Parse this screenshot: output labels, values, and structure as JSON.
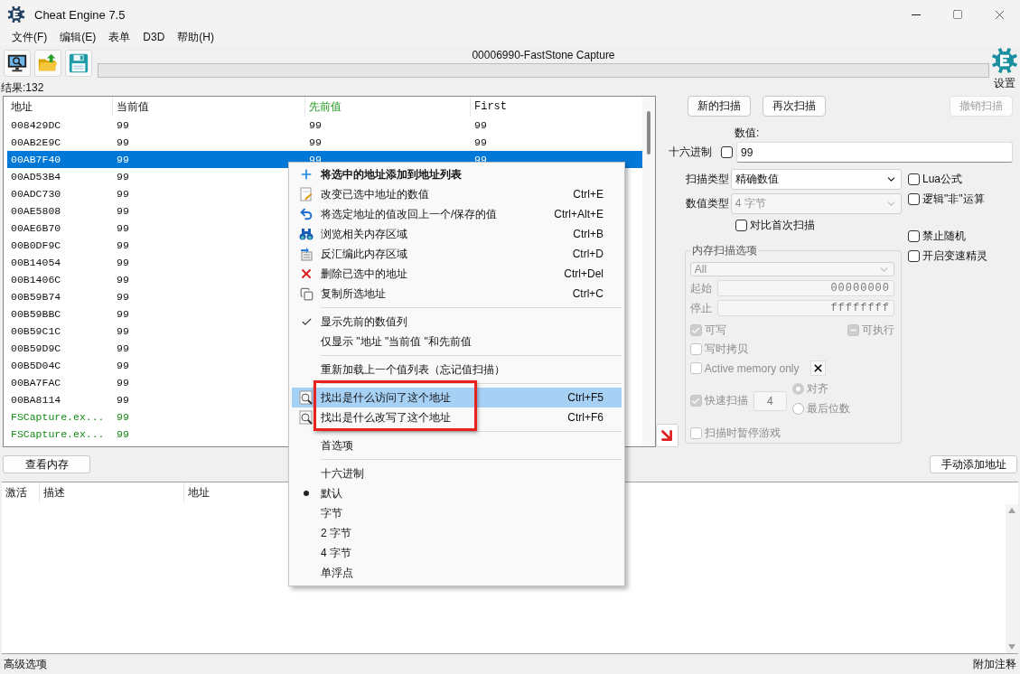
{
  "window": {
    "title": "Cheat Engine 7.5"
  },
  "menu": [
    "文件(F)",
    "编辑(E)",
    "表单",
    "D3D",
    "帮助(H)"
  ],
  "process": "00006990-FastStone Capture",
  "progress": {
    "level": 0
  },
  "settings_label": "设置",
  "result_count": "结果:132",
  "results": {
    "columns": [
      {
        "label": "地址",
        "highlight": false
      },
      {
        "label": "当前值",
        "highlight": false
      },
      {
        "label": "先前值",
        "highlight": true
      },
      {
        "label": "First",
        "highlight": false
      }
    ],
    "rows": [
      {
        "kind": "static",
        "address": "008429DC",
        "value": "99",
        "previous": "99",
        "first": "99",
        "selected": false
      },
      {
        "kind": "static",
        "address": "00AB2E9C",
        "value": "99",
        "previous": "99",
        "first": "99",
        "selected": false
      },
      {
        "kind": "static",
        "address": "00AB7F40",
        "value": "99",
        "previous": "99",
        "first": "99",
        "selected": true
      },
      {
        "kind": "static",
        "address": "00AD53B4",
        "value": "99",
        "selected": false
      },
      {
        "kind": "static",
        "address": "00ADC730",
        "value": "99",
        "selected": false
      },
      {
        "kind": "static",
        "address": "00AE5808",
        "value": "99",
        "selected": false
      },
      {
        "kind": "static",
        "address": "00AE6B70",
        "value": "99",
        "selected": false
      },
      {
        "kind": "static",
        "address": "00B0DF9C",
        "value": "99",
        "selected": false
      },
      {
        "kind": "static",
        "address": "00B14054",
        "value": "99",
        "selected": false
      },
      {
        "kind": "static",
        "address": "00B1406C",
        "value": "99",
        "selected": false
      },
      {
        "kind": "static",
        "address": "00B59B74",
        "value": "99",
        "selected": false
      },
      {
        "kind": "static",
        "address": "00B59BBC",
        "value": "99",
        "selected": false
      },
      {
        "kind": "static",
        "address": "00B59C1C",
        "value": "99",
        "selected": false
      },
      {
        "kind": "static",
        "address": "00B59D9C",
        "value": "99",
        "selected": false
      },
      {
        "kind": "static",
        "address": "00B5D04C",
        "value": "99",
        "selected": false
      },
      {
        "kind": "static",
        "address": "00BA7FAC",
        "value": "99",
        "selected": false
      },
      {
        "kind": "static",
        "address": "00BA8114",
        "value": "99",
        "selected": false
      },
      {
        "kind": "module",
        "address": "FSCapture.ex...",
        "value": "99",
        "selected": false
      },
      {
        "kind": "module",
        "address": "FSCapture.ex...",
        "value": "99",
        "selected": false
      }
    ]
  },
  "scan_buttons": [
    {
      "label": "新的扫描",
      "disabled": false
    },
    {
      "label": "再次扫描",
      "disabled": false
    },
    {
      "label": "撤销扫描",
      "disabled": true
    }
  ],
  "value": {
    "label": "数值:",
    "hex_label": "十六进制",
    "hex_checked": false,
    "value": "99"
  },
  "scan_type": {
    "label": "扫描类型",
    "value": "精确数值",
    "disabled": false
  },
  "value_type": {
    "label": "数值类型",
    "value": "4 字节",
    "disabled": true
  },
  "compare_first": {
    "label": "对比首次扫描",
    "checked": false
  },
  "options_top": [
    {
      "label": "Lua公式",
      "checked": false
    },
    {
      "label": "逻辑\"非\"运算",
      "checked": false
    }
  ],
  "options_bottom": [
    {
      "label": "禁止随机",
      "checked": false
    },
    {
      "label": "开启变速精灵",
      "checked": false
    }
  ],
  "memory_scan": {
    "title": "内存扫描选项",
    "disabled": true,
    "region": "All",
    "start_label": "起始",
    "start": "00000000",
    "stop_label": "停止",
    "stop": "ffffffff",
    "writable": {
      "label": "可写",
      "checked": true
    },
    "executable": {
      "label": "可执行",
      "indeterminate": true
    },
    "copy_on_write": {
      "label": "写时拷贝",
      "checked": false
    },
    "active_memory": {
      "label": "Active memory only",
      "checked": false
    },
    "fast_scan": {
      "label": "快速扫描",
      "checked": true,
      "value": "4"
    },
    "alignment": [
      {
        "label": "对齐",
        "selected": true
      },
      {
        "label": "最后位数",
        "selected": false
      }
    ],
    "pause_game": {
      "label": "扫描时暂停游戏",
      "checked": false
    }
  },
  "view_memory": "查看内存",
  "add_address": "手动添加地址",
  "address_list": {
    "columns": [
      "激活",
      "描述",
      "地址"
    ]
  },
  "status_bar": {
    "left": "高级选项",
    "right": "附加注释"
  },
  "context_menu": {
    "items": [
      {
        "kind": "action",
        "label": "将选中的地址添加到地址列表",
        "default": true
      },
      {
        "kind": "action",
        "label": "改变已选中地址的数值",
        "shortcut": "Ctrl+E"
      },
      {
        "kind": "action",
        "label": "将选定地址的值改回上一个/保存的值",
        "shortcut": "Ctrl+Alt+E"
      },
      {
        "kind": "action",
        "label": "浏览相关内存区域",
        "shortcut": "Ctrl+B"
      },
      {
        "kind": "action",
        "label": "反汇编此内存区域",
        "shortcut": "Ctrl+D"
      },
      {
        "kind": "action",
        "label": "删除已选中的地址",
        "shortcut": "Ctrl+Del"
      },
      {
        "kind": "action",
        "label": "复制所选地址",
        "shortcut": "Ctrl+C"
      },
      {
        "kind": "separator"
      },
      {
        "kind": "check",
        "label": "显示先前的数值列",
        "checked": true
      },
      {
        "kind": "action",
        "label": "仅显示 \"地址 \"当前值 \"和先前值"
      },
      {
        "kind": "separator"
      },
      {
        "kind": "action",
        "label": "重新加载上一个值列表（忘记值扫描）"
      },
      {
        "kind": "separator"
      },
      {
        "kind": "action",
        "label": "找出是什么访问了这个地址",
        "shortcut": "Ctrl+F5",
        "highlighted": true,
        "annotated": true
      },
      {
        "kind": "action",
        "label": "找出是什么改写了这个地址",
        "shortcut": "Ctrl+F6",
        "highlighted": false,
        "annotated": true
      },
      {
        "kind": "separator"
      },
      {
        "kind": "action",
        "label": "首选项"
      },
      {
        "kind": "separator"
      },
      {
        "kind": "check",
        "label": "十六进制",
        "checked": false
      },
      {
        "kind": "radio",
        "label": "默认",
        "selected": true
      },
      {
        "kind": "radio",
        "label": "字节",
        "selected": false
      },
      {
        "kind": "radio",
        "label": "2 字节",
        "selected": false
      },
      {
        "kind": "radio",
        "label": "4 字节",
        "selected": false
      },
      {
        "kind": "radio",
        "label": "单浮点",
        "selected": false
      }
    ]
  }
}
